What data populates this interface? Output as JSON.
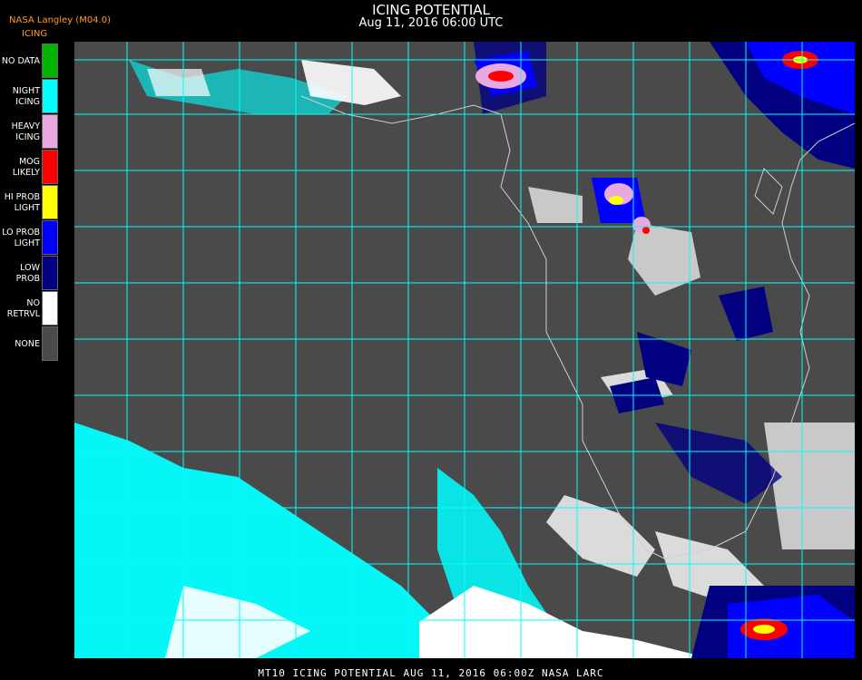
{
  "header": {
    "title": "ICING POTENTIAL",
    "datetime": "Aug 11, 2016 06:00 UTC",
    "provider": "NASA Langley (M04.0)",
    "product": "ICING"
  },
  "legend": [
    {
      "label": "NO DATA",
      "color": "#00b400"
    },
    {
      "label": "NIGHT\nICING",
      "color": "#00ffff"
    },
    {
      "label": "HEAVY\nICING",
      "color": "#e8a8e0"
    },
    {
      "label": "MOG\nLIKELY",
      "color": "#ff0000"
    },
    {
      "label": "HI PROB\nLIGHT",
      "color": "#ffff00"
    },
    {
      "label": "LO PROB\nLIGHT",
      "color": "#0000ff"
    },
    {
      "label": "LOW\nPROB",
      "color": "#000080"
    },
    {
      "label": "NO\nRETRVL",
      "color": "#ffffff"
    },
    {
      "label": "NONE",
      "color": "#4a4a4a"
    }
  ],
  "map": {
    "grid_color": "#00ffff",
    "background_color": "#4a4a4a",
    "coast_color": "#cfcfcf"
  },
  "footer": {
    "text": "MT10  ICING POTENTIAL   AUG 11, 2016 06:00Z   NASA LARC"
  }
}
